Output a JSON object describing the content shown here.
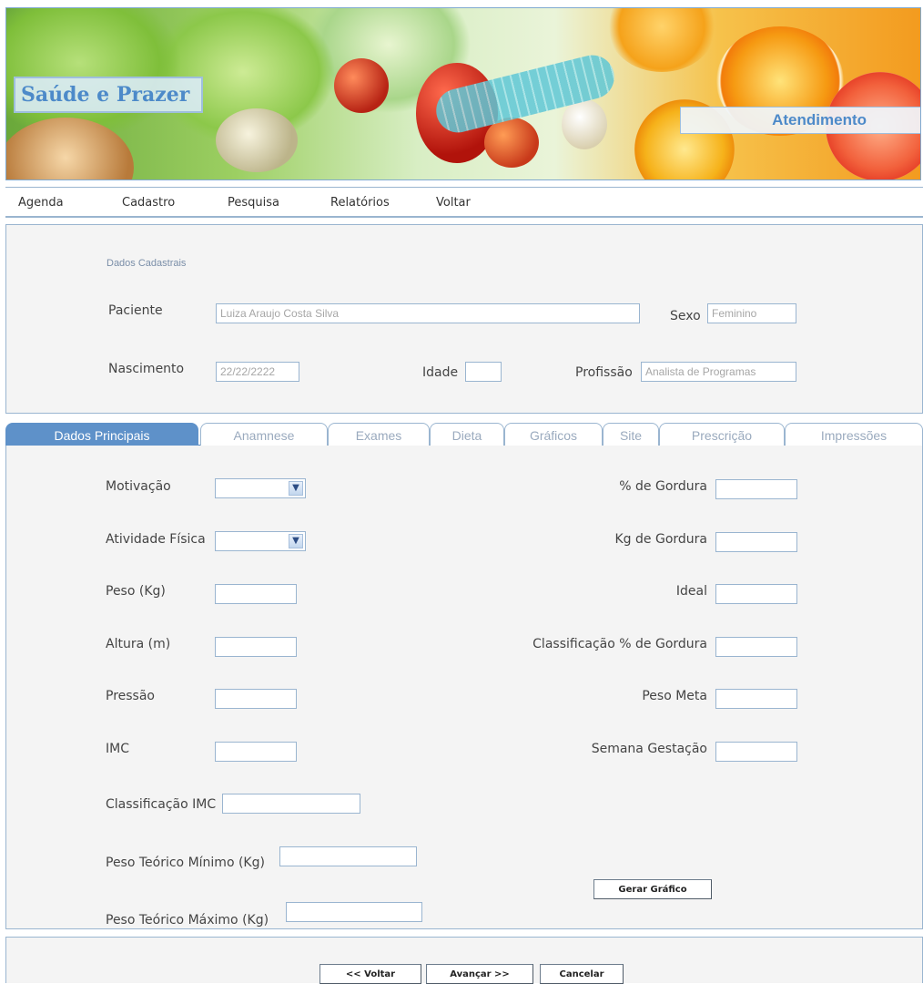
{
  "header": {
    "logo": "Saúde e Prazer",
    "section": "Atendimento"
  },
  "menu": {
    "items": [
      "Agenda",
      "Cadastro",
      "Pesquisa",
      "Relatórios",
      "Voltar"
    ]
  },
  "dados_cadastrais": {
    "title": "Dados Cadastrais",
    "paciente_label": "Paciente",
    "paciente_value": "Luiza Araujo Costa Silva",
    "sexo_label": "Sexo",
    "sexo_value": "Feminino",
    "nascimento_label": "Nascimento",
    "nascimento_value": "22/22/2222",
    "idade_label": "Idade",
    "idade_value": "",
    "profissao_label": "Profissão",
    "profissao_value": "Analista de Programas"
  },
  "tabs": [
    {
      "label": "Dados Principais",
      "active": true
    },
    {
      "label": "Anamnese",
      "active": false
    },
    {
      "label": "Exames",
      "active": false
    },
    {
      "label": "Dieta",
      "active": false
    },
    {
      "label": "Gráficos",
      "active": false
    },
    {
      "label": "Site",
      "active": false
    },
    {
      "label": "Prescrição",
      "active": false
    },
    {
      "label": "Impressões",
      "active": false
    }
  ],
  "form": {
    "left": {
      "motivacao": "Motivação",
      "atividade_fisica": "Atividade Física",
      "peso": "Peso (Kg)",
      "altura": "Altura (m)",
      "pressao": "Pressão",
      "imc": "IMC",
      "classificacao_imc": "Classificação IMC",
      "peso_teorico_min": "Peso Teórico Mínimo (Kg)",
      "peso_teorico_max": "Peso Teórico Máximo (Kg)"
    },
    "right": {
      "perc_gordura": "% de Gordura",
      "kg_gordura": "Kg de Gordura",
      "ideal": "Ideal",
      "classificacao_gordura": "Classificação % de Gordura",
      "peso_meta": "Peso Meta",
      "semana_gestacao": "Semana Gestação"
    },
    "gerar_grafico": "Gerar Gráfico"
  },
  "footer": {
    "voltar": "<< Voltar",
    "avancar": "Avançar >>",
    "cancelar": "Cancelar"
  },
  "colors": {
    "accent": "#5e91c9",
    "border": "#9ab5d0",
    "panel_bg": "#f4f4f4"
  }
}
